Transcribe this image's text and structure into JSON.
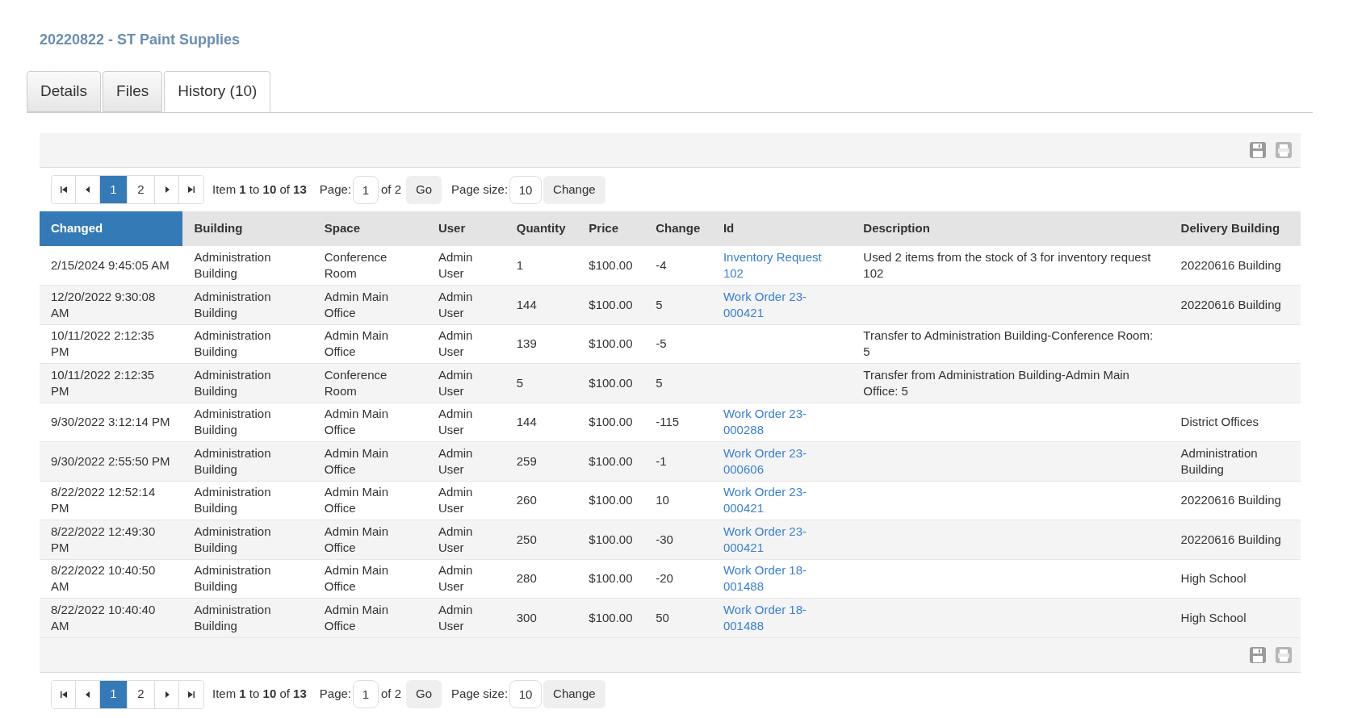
{
  "title": "20220822 - ST Paint Supplies",
  "tabs": [
    {
      "label": "Details",
      "selected": false
    },
    {
      "label": "Files",
      "selected": false
    },
    {
      "label": "History (10)",
      "selected": true
    }
  ],
  "top_pager": {
    "pages": [
      {
        "label": "1",
        "selected": true
      },
      {
        "label": "2",
        "selected": false
      }
    ],
    "summary": "Item **1** to **10** of **13**",
    "page_label": "Page:",
    "page_value": "1",
    "of_label": "of 2",
    "go": "Go",
    "size_label": "Page size:",
    "size_value": "10",
    "change": "Change"
  },
  "table": {
    "columns": [
      {
        "label": "Changed",
        "selected": true
      },
      {
        "label": "Building",
        "selected": false
      },
      {
        "label": "Space",
        "selected": false
      },
      {
        "label": "User",
        "selected": false
      },
      {
        "label": "Quantity",
        "selected": false
      },
      {
        "label": "Price",
        "selected": false
      },
      {
        "label": "Change",
        "selected": false
      },
      {
        "label": "Id",
        "selected": false
      },
      {
        "label": "Description",
        "selected": false
      },
      {
        "label": "Delivery Building",
        "selected": false
      }
    ],
    "rows": [
      [
        "2/15/2024 9:45:05 AM",
        "Administration Building",
        "Conference Room",
        "Admin User",
        "1",
        "$100.00",
        "-4",
        "Inventory Request 102",
        "Used 2 items from the stock of 3 for inventory request 102",
        "20220616 Building"
      ],
      [
        "12/20/2022 9:30:08 AM",
        "Administration Building",
        "Admin Main Office",
        "Admin User",
        "144",
        "$100.00",
        "5",
        "Work Order 23-000421",
        "",
        "20220616 Building"
      ],
      [
        "10/11/2022 2:12:35 PM",
        "Administration Building",
        "Admin Main Office",
        "Admin User",
        "139",
        "$100.00",
        "-5",
        "",
        "Transfer to Administration Building-Conference Room: 5",
        ""
      ],
      [
        "10/11/2022 2:12:35 PM",
        "Administration Building",
        "Conference Room",
        "Admin User",
        "5",
        "$100.00",
        "5",
        "",
        "Transfer from Administration Building-Admin Main Office: 5",
        ""
      ],
      [
        "9/30/2022 3:12:14 PM",
        "Administration Building",
        "Admin Main Office",
        "Admin User",
        "144",
        "$100.00",
        "-115",
        "Work Order 23-000288",
        "",
        "District Offices"
      ],
      [
        "9/30/2022 2:55:50 PM",
        "Administration Building",
        "Admin Main Office",
        "Admin User",
        "259",
        "$100.00",
        "-1",
        "Work Order 23-000606",
        "",
        "Administration Building"
      ],
      [
        "8/22/2022 12:52:14 PM",
        "Administration Building",
        "Admin Main Office",
        "Admin User",
        "260",
        "$100.00",
        "10",
        "Work Order 23-000421",
        "",
        "20220616 Building"
      ],
      [
        "8/22/2022 12:49:30 PM",
        "Administration Building",
        "Admin Main Office",
        "Admin User",
        "250",
        "$100.00",
        "-30",
        "Work Order 23-000421",
        "",
        "20220616 Building"
      ],
      [
        "8/22/2022 10:40:50 AM",
        "Administration Building",
        "Admin Main Office",
        "Admin User",
        "280",
        "$100.00",
        "-20",
        "Work Order 18-001488",
        "",
        "High School"
      ],
      [
        "8/22/2022 10:40:40 AM",
        "Administration Building",
        "Admin Main Office",
        "Admin User",
        "300",
        "$100.00",
        "50",
        "Work Order 18-001488",
        "",
        "High School"
      ]
    ]
  },
  "bottom_pager": {
    "pages": [
      {
        "label": "1",
        "selected": true
      },
      {
        "label": "2",
        "selected": false
      }
    ],
    "summary": "Item **1** to **10** of **13**",
    "page_label": "Page:",
    "page_value": "1",
    "of_label": "of 2",
    "go": "Go",
    "size_label": "Page size:",
    "size_value": "10",
    "change": "Change"
  }
}
